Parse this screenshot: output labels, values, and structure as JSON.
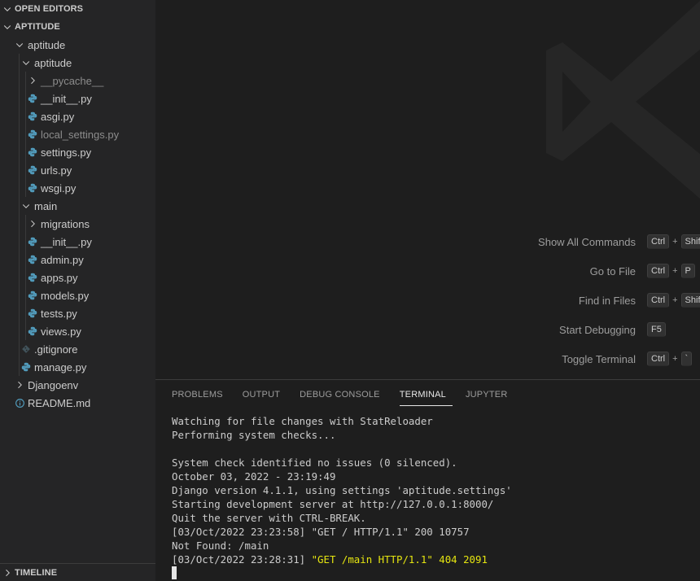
{
  "sidebar": {
    "open_editors": "OPEN EDITORS",
    "project": "APTITUDE",
    "timeline": "TIMELINE",
    "tree": [
      {
        "label": "aptitude",
        "depth": 1,
        "kind": "folder-open"
      },
      {
        "label": "aptitude",
        "depth": 2,
        "kind": "folder-open"
      },
      {
        "label": "__pycache__",
        "depth": 3,
        "kind": "folder-closed",
        "dim": true
      },
      {
        "label": "__init__.py",
        "depth": 3,
        "kind": "python"
      },
      {
        "label": "asgi.py",
        "depth": 3,
        "kind": "python"
      },
      {
        "label": "local_settings.py",
        "depth": 3,
        "kind": "python",
        "dim": true
      },
      {
        "label": "settings.py",
        "depth": 3,
        "kind": "python"
      },
      {
        "label": "urls.py",
        "depth": 3,
        "kind": "python"
      },
      {
        "label": "wsgi.py",
        "depth": 3,
        "kind": "python"
      },
      {
        "label": "main",
        "depth": 2,
        "kind": "folder-open"
      },
      {
        "label": "migrations",
        "depth": 3,
        "kind": "folder-closed"
      },
      {
        "label": "__init__.py",
        "depth": 3,
        "kind": "python"
      },
      {
        "label": "admin.py",
        "depth": 3,
        "kind": "python"
      },
      {
        "label": "apps.py",
        "depth": 3,
        "kind": "python"
      },
      {
        "label": "models.py",
        "depth": 3,
        "kind": "python"
      },
      {
        "label": "tests.py",
        "depth": 3,
        "kind": "python"
      },
      {
        "label": "views.py",
        "depth": 3,
        "kind": "python"
      },
      {
        "label": ".gitignore",
        "depth": 2,
        "kind": "git"
      },
      {
        "label": "manage.py",
        "depth": 2,
        "kind": "python"
      },
      {
        "label": "Djangoenv",
        "depth": 1,
        "kind": "folder-closed"
      },
      {
        "label": "README.md",
        "depth": 1,
        "kind": "info"
      }
    ]
  },
  "shortcuts": [
    {
      "label": "Show All Commands",
      "keys": [
        "Ctrl",
        "+",
        "Shif"
      ]
    },
    {
      "label": "Go to File",
      "keys": [
        "Ctrl",
        "+",
        "P"
      ]
    },
    {
      "label": "Find in Files",
      "keys": [
        "Ctrl",
        "+",
        "Shif"
      ]
    },
    {
      "label": "Start Debugging",
      "keys": [
        "F5"
      ]
    },
    {
      "label": "Toggle Terminal",
      "keys": [
        "Ctrl",
        "+",
        "`"
      ]
    }
  ],
  "panel": {
    "tabs": [
      "PROBLEMS",
      "OUTPUT",
      "DEBUG CONSOLE",
      "TERMINAL",
      "JUPYTER"
    ],
    "active_tab": "TERMINAL",
    "terminal_lines": [
      {
        "text": "Watching for file changes with StatReloader"
      },
      {
        "text": "Performing system checks..."
      },
      {
        "text": ""
      },
      {
        "text": "System check identified no issues (0 silenced)."
      },
      {
        "text": "October 03, 2022 - 23:19:49"
      },
      {
        "text": "Django version 4.1.1, using settings 'aptitude.settings'"
      },
      {
        "text": "Starting development server at http://127.0.0.1:8000/"
      },
      {
        "text": "Quit the server with CTRL-BREAK."
      },
      {
        "text": "[03/Oct/2022 23:23:58] \"GET / HTTP/1.1\" 200 10757"
      },
      {
        "text": "Not Found: /main"
      },
      {
        "text": "[03/Oct/2022 23:28:31] ",
        "highlight": "\"GET /main HTTP/1.1\" 404 2091"
      }
    ]
  },
  "colors": {
    "sidebar_bg": "#252526",
    "editor_bg": "#1e1e1e",
    "python_icon": "#519aba",
    "terminal_warning": "#e5e510"
  }
}
